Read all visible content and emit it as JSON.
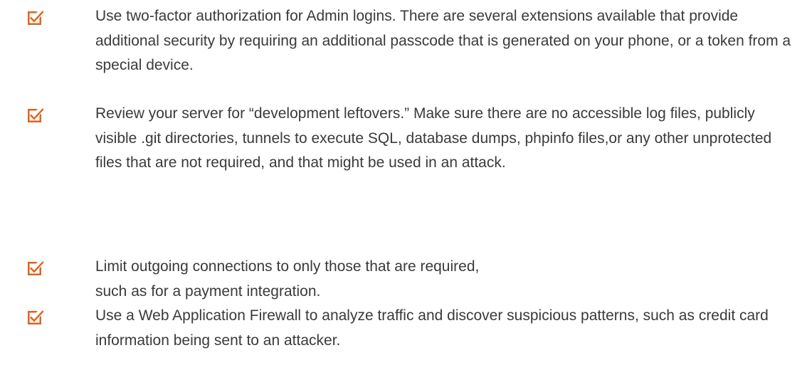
{
  "checklist": {
    "icon_color": "#e0631f",
    "items": [
      {
        "icon": "checked-box-icon",
        "text": "Use two-factor authorization for Admin logins. There are several extensions available that provide additional security by requiring an additional passcode that is generated on your phone, or a token from a special device."
      },
      {
        "icon": "checked-box-icon",
        "text": "Review your server for “development leftovers.” Make sure there are no accessible log files, publicly visible .git directories, tunnels to execute SQL, database dumps, phpinfo files,or any other unprotected files that are not required, and that might be used in an attack."
      },
      {
        "icon": "checked-box-icon",
        "text": "Limit outgoing connections to only those that are required, such as for a payment integration."
      },
      {
        "icon": "checked-box-icon",
        "text": "Use a Web Application Firewall to analyze traffic and discover suspicious patterns, such as credit card information being sent to an attacker."
      }
    ]
  }
}
